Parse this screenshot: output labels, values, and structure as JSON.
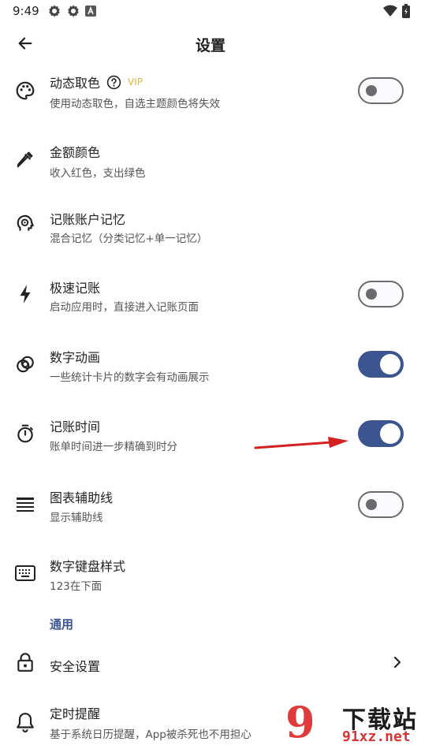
{
  "status_bar": {
    "time": "9:49",
    "left_icons": [
      "settings-gear-icon",
      "settings-gear-icon",
      "letter-a-icon"
    ],
    "right_icons": [
      "wifi-icon",
      "battery-icon"
    ]
  },
  "app_bar": {
    "back_icon": "arrow-left-icon",
    "title": "设置"
  },
  "settings": [
    {
      "icon": "palette-icon",
      "title": "动态取色",
      "help_icon": "help-circle-icon",
      "badge": "VIP",
      "subtitle": "使用动态取色，自选主题颜色将失效",
      "control": "switch",
      "on": false
    },
    {
      "icon": "eyedropper-icon",
      "title": "金额颜色",
      "subtitle": "收入红色，支出绿色",
      "control": "none"
    },
    {
      "icon": "brain-head-icon",
      "title": "记账账户记忆",
      "subtitle": "混合记忆（分类记忆+单一记忆）",
      "control": "none"
    },
    {
      "icon": "flash-icon",
      "title": "极速记账",
      "subtitle": "启动应用时，直接进入记账页面",
      "control": "switch",
      "on": false
    },
    {
      "icon": "rings-icon",
      "title": "数字动画",
      "subtitle": "一些统计卡片的数字会有动画展示",
      "control": "switch",
      "on": true
    },
    {
      "icon": "timer-icon",
      "title": "记账时间",
      "subtitle": "账单时间进一步精确到时分",
      "control": "switch",
      "on": true
    },
    {
      "icon": "lines-icon",
      "title": "图表辅助线",
      "subtitle": "显示辅助线",
      "control": "switch",
      "on": false
    },
    {
      "icon": "keyboard-icon",
      "title": "数字键盘样式",
      "subtitle": "123在下面",
      "control": "none"
    }
  ],
  "section_general": "通用",
  "general": [
    {
      "icon": "lock-icon",
      "title": "安全设置",
      "control": "chevron",
      "chevron_icon": "chevron-right-icon"
    },
    {
      "icon": "bell-icon",
      "title": "定时提醒",
      "subtitle": "基于系统日历提醒，App被杀死也不用担心",
      "control": "chevron",
      "chevron_icon": "chevron-right-icon"
    }
  ],
  "annotation": {
    "icon": "red-arrow-icon",
    "color": "#d42020"
  },
  "watermark": {
    "logo_text": "9",
    "title": "下载站",
    "url": "91xz.net"
  },
  "colors": {
    "accent": "#3c5590",
    "vip": "#e5b632",
    "switch_off": "#6a6a70"
  }
}
